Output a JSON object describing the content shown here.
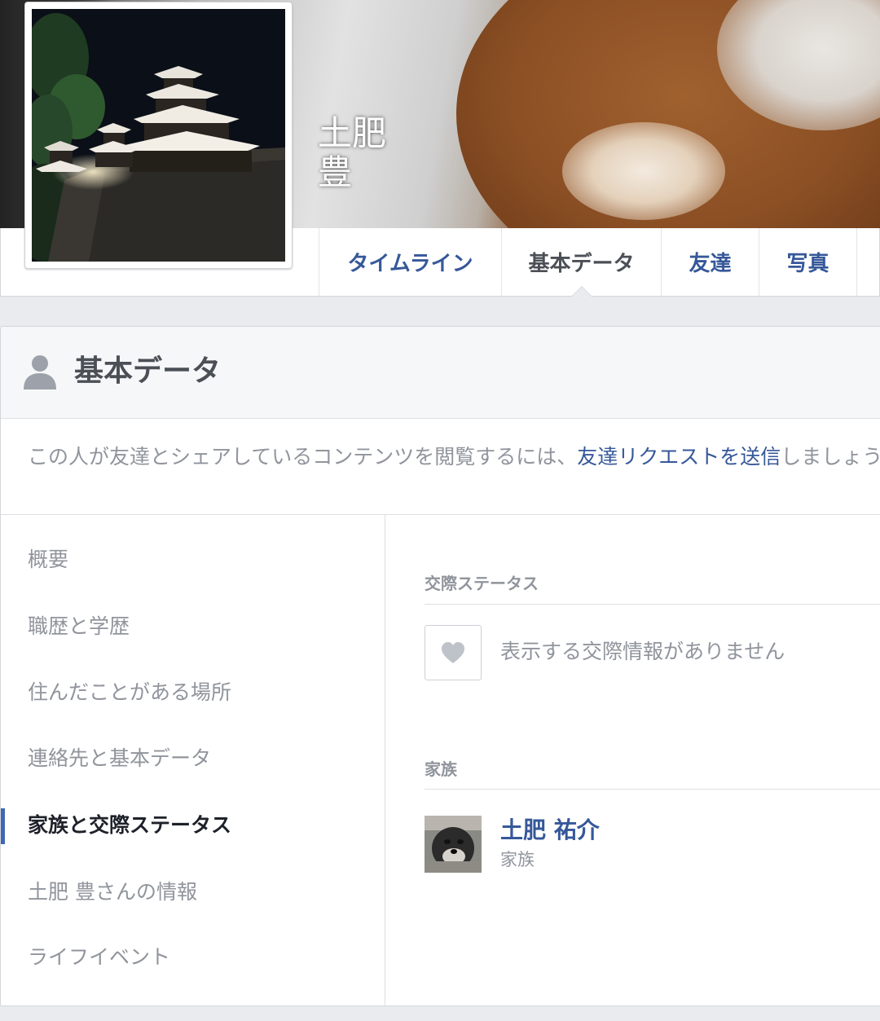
{
  "profile": {
    "name_line1": "土肥",
    "name_line2": "豊"
  },
  "nav": {
    "tabs": [
      {
        "label": "タイムライン",
        "active": false
      },
      {
        "label": "基本データ",
        "active": true
      },
      {
        "label": "友達",
        "active": false
      },
      {
        "label": "写真",
        "active": false
      }
    ]
  },
  "about": {
    "title": "基本データ",
    "notice_prefix": "この人が友達とシェアしているコンテンツを閲覧するには、",
    "notice_link": "友達リクエストを送信",
    "notice_suffix": "しましょう。",
    "sidebar": [
      {
        "label": "概要",
        "active": false
      },
      {
        "label": "職歴と学歴",
        "active": false
      },
      {
        "label": "住んだことがある場所",
        "active": false
      },
      {
        "label": "連絡先と基本データ",
        "active": false
      },
      {
        "label": "家族と交際ステータス",
        "active": true
      },
      {
        "label": "土肥 豊さんの情報",
        "active": false
      },
      {
        "label": "ライフイベント",
        "active": false
      }
    ],
    "relationship": {
      "title": "交際ステータス",
      "empty_text": "表示する交際情報がありません"
    },
    "family": {
      "title": "家族",
      "members": [
        {
          "name": "土肥 祐介",
          "relation": "家族"
        }
      ]
    }
  },
  "icons": {
    "header_icon": "person-icon",
    "relationship_icon": "heart-icon"
  },
  "colors": {
    "link": "#365899",
    "muted": "#90949c",
    "accent": "#4267b2"
  }
}
